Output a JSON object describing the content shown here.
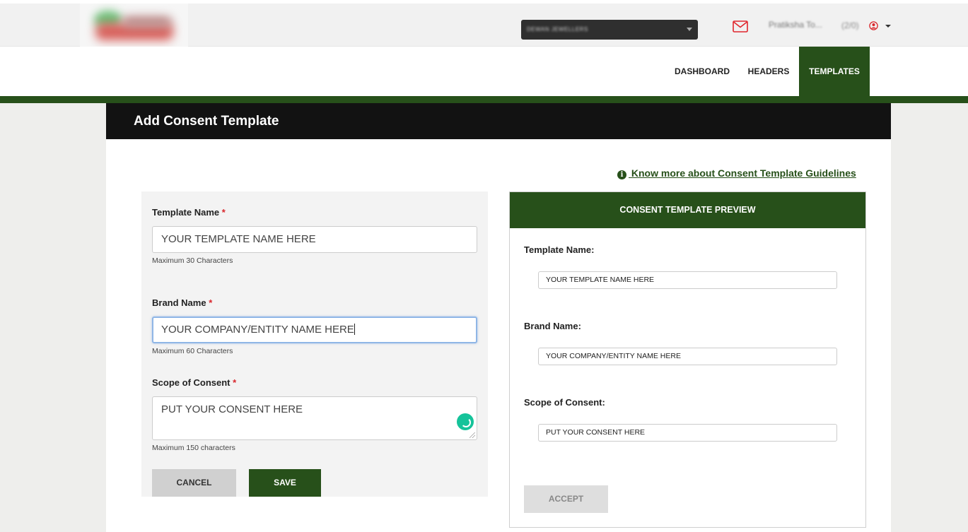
{
  "header": {
    "account_select": "DEWAN JEWELLERS",
    "user_name": "Pratiksha To...",
    "user_count": "(2/0)"
  },
  "nav": {
    "items": [
      {
        "label": "DASHBOARD"
      },
      {
        "label": "HEADERS"
      },
      {
        "label": "TEMPLATES",
        "active": true
      }
    ]
  },
  "page": {
    "title": "Add Consent Template",
    "guideline_link": " Know more about Consent Template Guidelines"
  },
  "form": {
    "template_name": {
      "label": "Template Name",
      "required": "*",
      "value": "YOUR TEMPLATE NAME HERE",
      "hint": "Maximum 30 Characters"
    },
    "brand_name": {
      "label": "Brand Name",
      "required": "*",
      "value": "YOUR COMPANY/ENTITY NAME HERE",
      "hint": "Maximum 60 Characters"
    },
    "scope": {
      "label": "Scope of Consent",
      "required": "*",
      "value": "PUT YOUR CONSENT HERE",
      "hint": "Maximum 150 characters"
    },
    "cancel_label": "CANCEL",
    "save_label": "SAVE"
  },
  "preview": {
    "title": "CONSENT TEMPLATE PREVIEW",
    "template_name_label": "Template Name:",
    "template_name_value": "YOUR TEMPLATE NAME HERE",
    "brand_name_label": "Brand Name:",
    "brand_name_value": "YOUR COMPANY/ENTITY NAME HERE",
    "scope_label": "Scope of Consent:",
    "scope_value": "PUT YOUR CONSENT HERE",
    "accept_label": "ACCEPT"
  },
  "colors": {
    "brand_green": "#27501a",
    "header_black": "#121212",
    "required_red": "#d9262c",
    "mail_red": "#e0262d"
  }
}
